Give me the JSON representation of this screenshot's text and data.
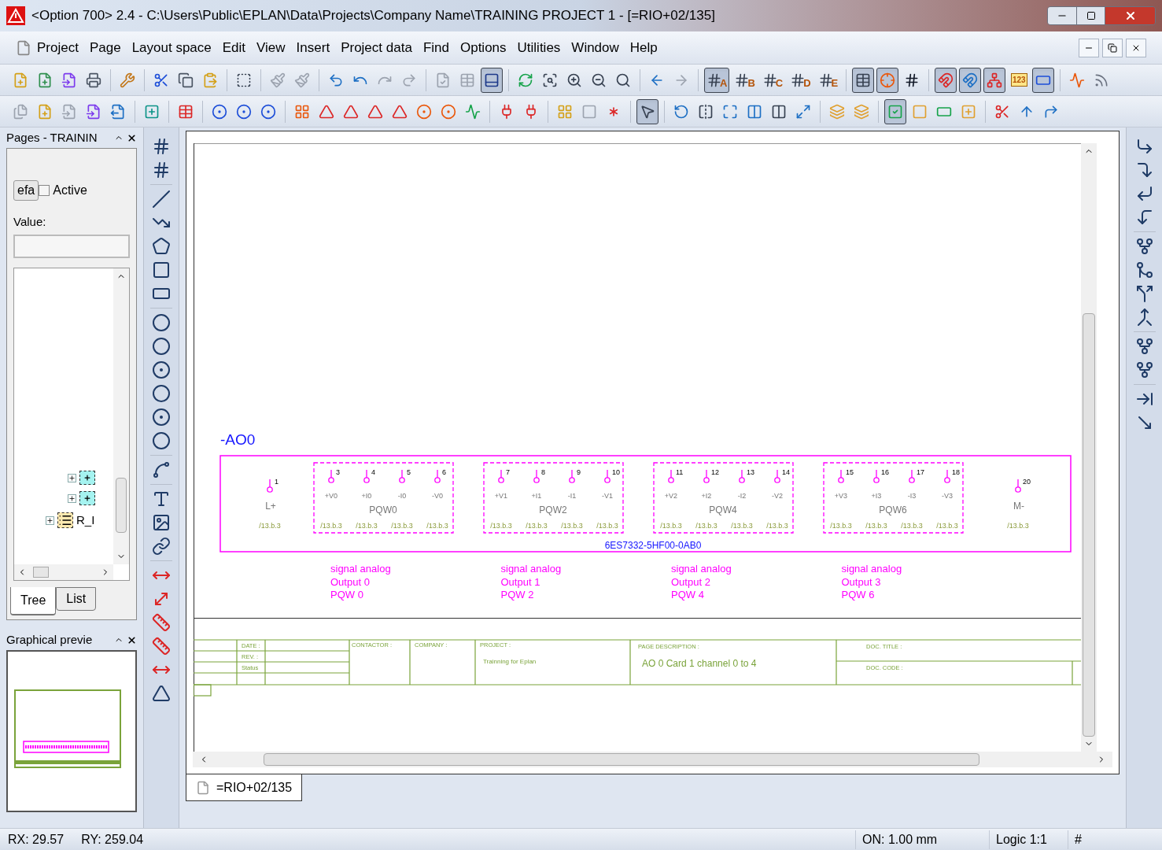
{
  "window": {
    "title": "<Option 700> 2.4 - C:\\Users\\Public\\EPLAN\\Data\\Projects\\Company Name\\TRAINING PROJECT 1 - [=RIO+02/135]"
  },
  "menu": [
    {
      "label": "Project"
    },
    {
      "label": "Page"
    },
    {
      "label": "Layout space"
    },
    {
      "label": "Edit"
    },
    {
      "label": "View"
    },
    {
      "label": "Insert"
    },
    {
      "label": "Project data"
    },
    {
      "label": "Find"
    },
    {
      "label": "Options"
    },
    {
      "label": "Utilities"
    },
    {
      "label": "Window"
    },
    {
      "label": "Help"
    }
  ],
  "toolbar_1": [
    {
      "pressed": false
    },
    {
      "pressed": false
    },
    {
      "pressed": false
    },
    {
      "pressed": false
    },
    {
      "pressed": false
    },
    {
      "pressed": false
    },
    {
      "pressed": false
    },
    {
      "pressed": false
    },
    {
      "pressed": false
    },
    {
      "pressed": false
    },
    {
      "pressed": false
    },
    {
      "pressed": false
    },
    {
      "pressed": false
    },
    {
      "pressed": false
    },
    {
      "pressed": false
    },
    {
      "pressed": false
    },
    {
      "pressed": false
    },
    {
      "pressed": true
    },
    {
      "pressed": false
    },
    {
      "pressed": false
    },
    {
      "pressed": false
    },
    {
      "pressed": false
    },
    {
      "pressed": false
    },
    {
      "pressed": false
    },
    {
      "pressed": false
    },
    {
      "pressed": true,
      "letter": "A"
    },
    {
      "pressed": false,
      "letter": "B"
    },
    {
      "pressed": false,
      "letter": "C"
    },
    {
      "pressed": false,
      "letter": "D"
    },
    {
      "pressed": false,
      "letter": "E"
    },
    {
      "pressed": true
    },
    {
      "pressed": true
    },
    {
      "pressed": false
    },
    {
      "pressed": true
    },
    {
      "pressed": true
    },
    {
      "pressed": true
    },
    {
      "pressed": false,
      "text": "123"
    },
    {
      "pressed": true
    },
    {
      "pressed": false
    },
    {
      "pressed": false
    }
  ],
  "toolbar_2": [
    {
      "pressed": false
    },
    {
      "pressed": false
    },
    {
      "pressed": false
    },
    {
      "pressed": false
    },
    {
      "pressed": false
    },
    {
      "pressed": false
    },
    {
      "pressed": false
    },
    {
      "pressed": false
    },
    {
      "pressed": false
    },
    {
      "pressed": false
    },
    {
      "pressed": false
    },
    {
      "pressed": false
    },
    {
      "pressed": false
    },
    {
      "pressed": false
    },
    {
      "pressed": false
    },
    {
      "pressed": false
    },
    {
      "pressed": false
    },
    {
      "pressed": false
    },
    {
      "pressed": false
    },
    {
      "pressed": false
    },
    {
      "pressed": false
    },
    {
      "pressed": false
    },
    {
      "pressed": false
    },
    {
      "pressed": true
    },
    {
      "pressed": false
    },
    {
      "pressed": false
    },
    {
      "pressed": false
    },
    {
      "pressed": false
    },
    {
      "pressed": false
    },
    {
      "pressed": false
    },
    {
      "pressed": false
    },
    {
      "pressed": false
    },
    {
      "pressed": true
    },
    {
      "pressed": false
    },
    {
      "pressed": false
    },
    {
      "pressed": false
    },
    {
      "pressed": false
    },
    {
      "pressed": false
    },
    {
      "pressed": false
    }
  ],
  "pages_panel": {
    "title": "Pages - TRAININ",
    "filter_button": "efa",
    "active": {
      "label": "Active",
      "checked": false
    },
    "value_label": "Value:",
    "tree": [
      {
        "kind": "device",
        "expanded": false
      },
      {
        "kind": "device",
        "expanded": false
      },
      {
        "kind": "list",
        "label": "R_I",
        "expanded": false
      }
    ],
    "tabs": [
      {
        "label": "Tree",
        "selected": true
      },
      {
        "label": "List",
        "selected": false
      }
    ]
  },
  "preview_panel": {
    "title": "Graphical previe"
  },
  "schematic": {
    "device_tag": "-AO0",
    "part_number": "6ES7332-5HF00-0AB0",
    "modules": [
      {
        "kind": "terminal",
        "number": "1",
        "label": "L+",
        "ref": "/13.b.3"
      },
      {
        "kind": "channel",
        "name": "PQW0",
        "pins": [
          {
            "number": "3",
            "label": "+V0",
            "ref": "/13.b.3"
          },
          {
            "number": "4",
            "label": "+I0",
            "ref": "/13.b.3"
          },
          {
            "number": "5",
            "label": "-I0",
            "ref": "/13.b.3"
          },
          {
            "number": "6",
            "label": "-V0",
            "ref": "/13.b.3"
          }
        ]
      },
      {
        "kind": "channel",
        "name": "PQW2",
        "pins": [
          {
            "number": "7",
            "label": "+V1",
            "ref": "/13.b.3"
          },
          {
            "number": "8",
            "label": "+I1",
            "ref": "/13.b.3"
          },
          {
            "number": "9",
            "label": "-I1",
            "ref": "/13.b.3"
          },
          {
            "number": "10",
            "label": "-V1",
            "ref": "/13.b.3"
          }
        ]
      },
      {
        "kind": "channel",
        "name": "PQW4",
        "pins": [
          {
            "number": "11",
            "label": "+V2",
            "ref": "/13.b.3"
          },
          {
            "number": "12",
            "label": "+I2",
            "ref": "/13.b.3"
          },
          {
            "number": "13",
            "label": "-I2",
            "ref": "/13.b.3"
          },
          {
            "number": "14",
            "label": "-V2",
            "ref": "/13.b.3"
          }
        ]
      },
      {
        "kind": "channel",
        "name": "PQW6",
        "pins": [
          {
            "number": "15",
            "label": "+V3",
            "ref": "/13.b.3"
          },
          {
            "number": "16",
            "label": "+I3",
            "ref": "/13.b.3"
          },
          {
            "number": "17",
            "label": "-I3",
            "ref": "/13.b.3"
          },
          {
            "number": "18",
            "label": "-V3",
            "ref": "/13.b.3"
          }
        ]
      },
      {
        "kind": "terminal",
        "number": "20",
        "label": "M-",
        "ref": "/13.b.3"
      }
    ],
    "notes": [
      [
        "signal analog",
        "Output 0",
        "PQW 0"
      ],
      [
        "signal analog",
        "Output 1",
        "PQW 2"
      ],
      [
        "signal analog",
        "Output 2",
        "PQW 4"
      ],
      [
        "signal analog",
        "Output 3",
        "PQW 6"
      ]
    ]
  },
  "title_block": {
    "date_label": "DATE :",
    "rev_label": "REV. :",
    "status_label": "Status",
    "contractor_label": "CONTACTOR :",
    "company_label": "COMPANY :",
    "project_label": "PROJECT :",
    "project": "Trainning for Eplan",
    "page_description_label": "PAGE DESCRIPTION :",
    "page_description": "AO 0 Card 1 channel 0 to 4",
    "doc_title_label": "DOC. TITLE :",
    "doc_code_label": "DOC. CODE :"
  },
  "page_tab": "=RIO+02/135",
  "status_bar": {
    "rx": "RX: 29.57",
    "ry": "RY: 259.04",
    "grid": "ON: 1.00 mm",
    "logic": "Logic 1:1",
    "hash": "#"
  }
}
